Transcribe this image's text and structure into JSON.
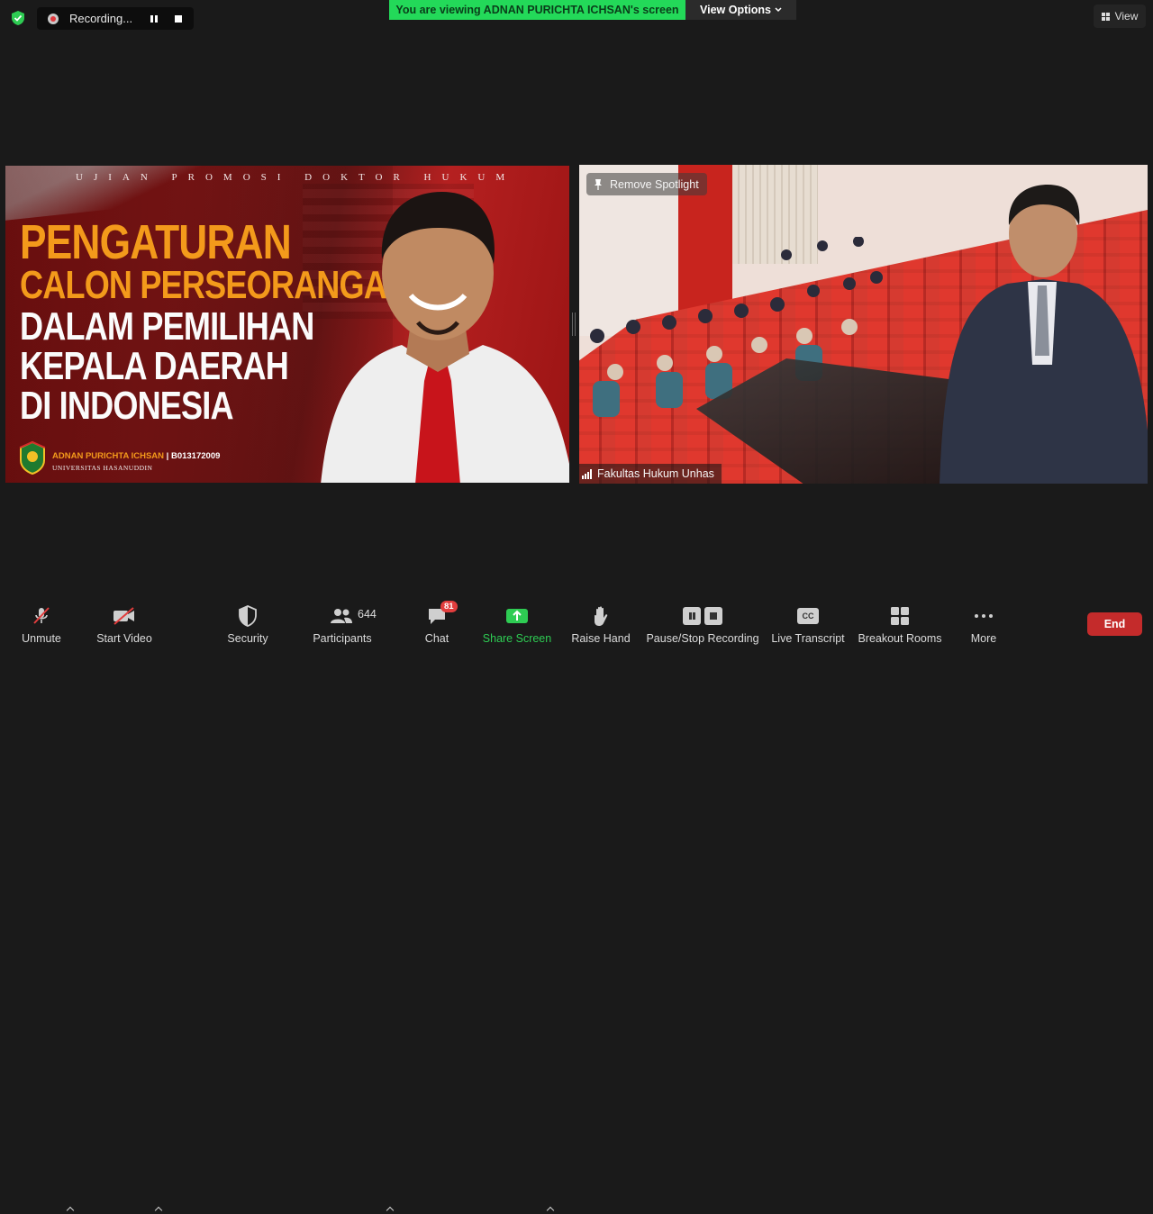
{
  "top": {
    "recording_label": "Recording...",
    "viewing_banner": "You are viewing ADNAN PURICHTA ICHSAN's screen",
    "view_options_label": "View Options",
    "view_label": "View"
  },
  "shared_screen": {
    "kicker": "UJIAN PROMOSI DOKTOR HUKUM",
    "title_lines": [
      "PENGATURAN",
      "CALON PERSEORANGAN",
      "DALAM PEMILIHAN",
      "KEPALA DAERAH",
      "DI INDONESIA"
    ],
    "candidate_name": "ADNAN PURICHTA ICHSAN",
    "candidate_id": "| B013172009",
    "university": "UNIVERSITAS HASANUDDIN"
  },
  "video": {
    "spotlight_button": "Remove Spotlight",
    "participant_name": "Fakultas Hukum Unhas"
  },
  "toolbar": {
    "unmute": "Unmute",
    "start_video": "Start Video",
    "security": "Security",
    "participants": "Participants",
    "participants_count": "644",
    "chat": "Chat",
    "chat_badge": "81",
    "share_screen": "Share Screen",
    "raise_hand": "Raise Hand",
    "pause_stop_recording": "Pause/Stop Recording",
    "live_transcript": "Live Transcript",
    "cc_label": "CC",
    "breakout_rooms": "Breakout Rooms",
    "more": "More",
    "end": "End"
  },
  "colors": {
    "banner_green": "#23d959",
    "share_green": "#2ecc53",
    "end_red": "#c42b2b",
    "title_orange": "#f39a1b"
  }
}
